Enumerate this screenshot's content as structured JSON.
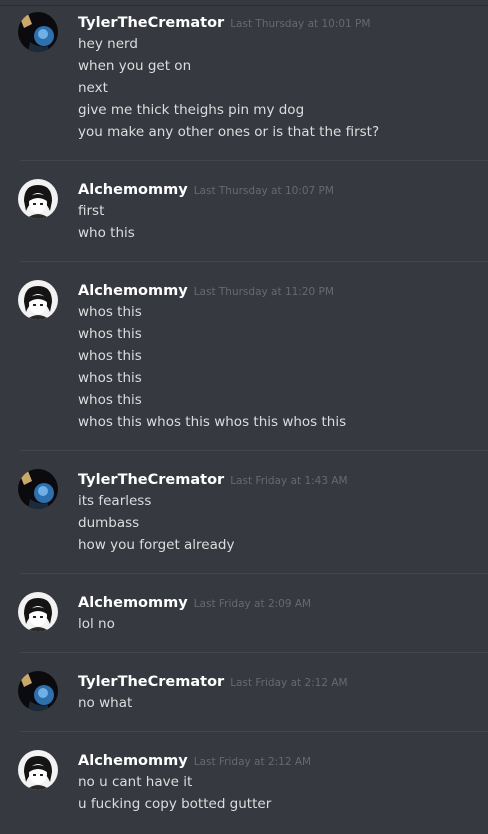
{
  "groups": [
    {
      "username": "TylerTheCremator",
      "timestamp": "Last Thursday at 10:01 PM",
      "avatar": "tyler-avatar-icon",
      "messages": [
        "hey nerd",
        "when you get on",
        "next",
        "give me thick theighs pin my dog",
        "you make any other ones or is that the first?"
      ]
    },
    {
      "username": "Alchemommy",
      "timestamp": "Last Thursday at 10:07 PM",
      "avatar": "alchemommy-avatar-icon",
      "messages": [
        "first",
        "who this"
      ]
    },
    {
      "username": "Alchemommy",
      "timestamp": "Last Thursday at 11:20 PM",
      "avatar": "alchemommy-avatar-icon",
      "messages": [
        "whos this",
        "whos this",
        "whos this",
        "whos this",
        "whos this",
        "whos this whos this whos this whos this"
      ]
    },
    {
      "username": "TylerTheCremator",
      "timestamp": "Last Friday at 1:43 AM",
      "avatar": "tyler-avatar-icon",
      "messages": [
        "its fearless",
        "dumbass",
        "how you forget already"
      ]
    },
    {
      "username": "Alchemommy",
      "timestamp": "Last Friday at 2:09 AM",
      "avatar": "alchemommy-avatar-icon",
      "messages": [
        "lol no"
      ]
    },
    {
      "username": "TylerTheCremator",
      "timestamp": "Last Friday at 2:12 AM",
      "avatar": "tyler-avatar-icon",
      "messages": [
        "no what"
      ]
    },
    {
      "username": "Alchemommy",
      "timestamp": "Last Friday at 2:12 AM",
      "avatar": "alchemommy-avatar-icon",
      "messages": [
        "no u cant have it",
        "u fucking copy botted gutter"
      ]
    }
  ],
  "colors": {
    "background": "#36393f",
    "username": "#ffffff",
    "timestamp": "#666a70",
    "message_text": "#dcddde",
    "divider": "#42454c"
  }
}
